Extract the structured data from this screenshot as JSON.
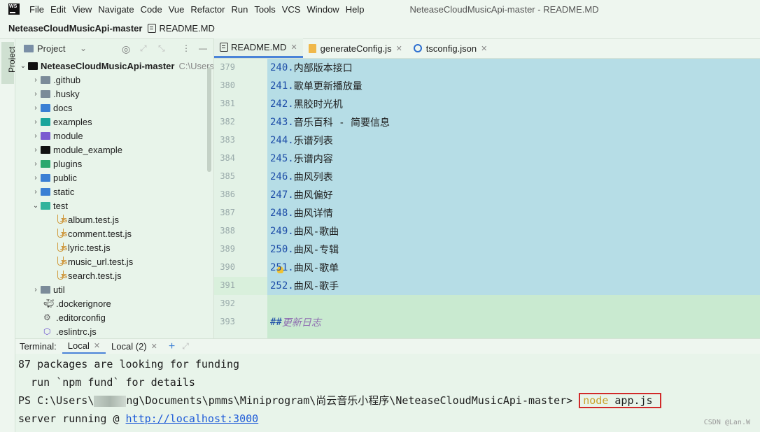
{
  "menubar": {
    "logo_text": "WS",
    "items": [
      "File",
      "Edit",
      "View",
      "Navigate",
      "Code",
      "Vue",
      "Refactor",
      "Run",
      "Tools",
      "VCS",
      "Window",
      "Help"
    ],
    "window_title": "NeteaseCloudMusicApi-master - README.MD"
  },
  "breadcrumb": {
    "project": "NeteaseCloudMusicApi-master",
    "file": "README.MD"
  },
  "sidebar": {
    "project_tab": "Project"
  },
  "project_panel": {
    "title": "Project",
    "tree": [
      {
        "name": "NeteaseCloudMusicApi-master",
        "hint": "C:\\Users",
        "type": "root"
      },
      {
        "name": ".github",
        "type": "folder",
        "color": "gray"
      },
      {
        "name": ".husky",
        "type": "folder",
        "color": "gray"
      },
      {
        "name": "docs",
        "type": "folder",
        "color": "blue"
      },
      {
        "name": "examples",
        "type": "folder",
        "color": "teal"
      },
      {
        "name": "module",
        "type": "folder",
        "color": "purple"
      },
      {
        "name": "module_example",
        "type": "folder",
        "color": "black"
      },
      {
        "name": "plugins",
        "type": "folder",
        "color": "green"
      },
      {
        "name": "public",
        "type": "folder",
        "color": "blue"
      },
      {
        "name": "static",
        "type": "folder",
        "color": "blue"
      },
      {
        "name": "test",
        "type": "folder-open",
        "color": "test"
      },
      {
        "name": "album.test.js",
        "type": "jsfile"
      },
      {
        "name": "comment.test.js",
        "type": "jsfile"
      },
      {
        "name": "lyric.test.js",
        "type": "jsfile"
      },
      {
        "name": "music_url.test.js",
        "type": "jsfile"
      },
      {
        "name": "search.test.js",
        "type": "jsfile"
      },
      {
        "name": "util",
        "type": "folder",
        "color": "gray"
      },
      {
        "name": ".dockerignore",
        "type": "file"
      },
      {
        "name": ".editorconfig",
        "type": "file"
      },
      {
        "name": ".eslintrc.js",
        "type": "file"
      }
    ]
  },
  "editor": {
    "tabs": [
      {
        "label": "README.MD",
        "active": true
      },
      {
        "label": "generateConfig.js",
        "active": false
      },
      {
        "label": "tsconfig.json",
        "active": false
      }
    ],
    "lines": [
      {
        "num": "379",
        "prefix": "240.",
        "text": " 内部版本接口"
      },
      {
        "num": "380",
        "prefix": "241.",
        "text": " 歌单更新播放量"
      },
      {
        "num": "381",
        "prefix": "242.",
        "text": " 黑胶时光机"
      },
      {
        "num": "382",
        "prefix": "243.",
        "text": " 音乐百科 - 简要信息"
      },
      {
        "num": "383",
        "prefix": "244.",
        "text": " 乐谱列表"
      },
      {
        "num": "384",
        "prefix": "245.",
        "text": " 乐谱内容"
      },
      {
        "num": "385",
        "prefix": "246.",
        "text": " 曲风列表"
      },
      {
        "num": "386",
        "prefix": "247.",
        "text": " 曲风偏好"
      },
      {
        "num": "387",
        "prefix": "248.",
        "text": " 曲风详情"
      },
      {
        "num": "388",
        "prefix": "249.",
        "text": " 曲风-歌曲"
      },
      {
        "num": "389",
        "prefix": "250.",
        "text": " 曲风-专辑"
      },
      {
        "num": "390",
        "prefix": "251.",
        "text": " 曲风-歌单"
      },
      {
        "num": "391",
        "prefix": "252.",
        "text": " 曲风-歌手"
      },
      {
        "num": "392",
        "prefix": "",
        "text": ""
      },
      {
        "num": "393",
        "prefix": "##",
        "text": " 更新日志"
      }
    ]
  },
  "terminal": {
    "label": "Terminal:",
    "tabs": [
      {
        "label": "Local",
        "active": true
      },
      {
        "label": "Local (2)",
        "active": false
      }
    ],
    "line1": "87 packages are looking for funding",
    "line2": "  run `npm fund` for details",
    "prompt_start": "PS C:\\Users\\",
    "prompt_end": "ng\\Documents\\pmms\\Miniprogram\\尚云音乐小程序\\NeteaseCloudMusicApi-master> ",
    "cmd_node": "node",
    "cmd_rest": " app.js",
    "line4_prefix": "server running @ ",
    "url": "http://localhost:3000"
  },
  "watermark": "CSDN @Lan.W"
}
